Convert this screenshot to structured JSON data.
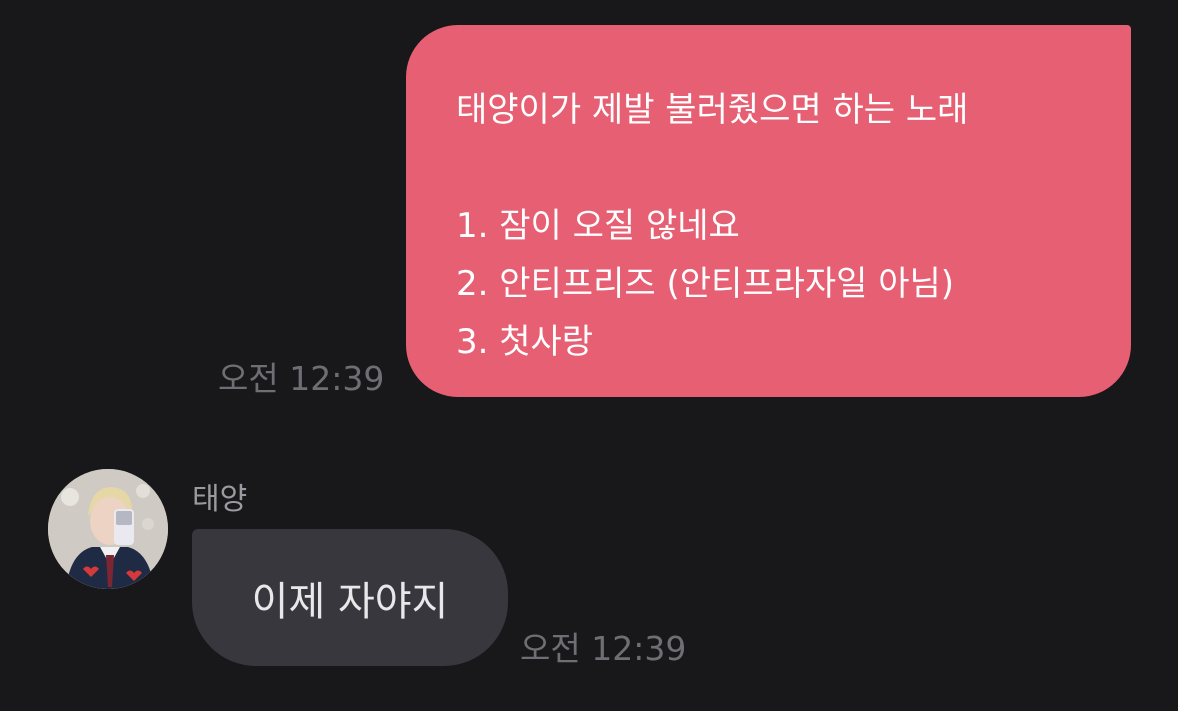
{
  "colors": {
    "background": "#18181b",
    "outgoing_bubble": "#e65f72",
    "incoming_bubble": "#37373d",
    "timestamp": "#6e6e74"
  },
  "messages": {
    "outgoing": {
      "lines": [
        "태양이가 제발 불러줬으면 하는 노래",
        "",
        "1. 잠이 오질 않네요",
        "2. 안티프리즈 (안티프라자일 아님)",
        "3. 첫사랑"
      ],
      "time": "오전 12:39"
    },
    "incoming": {
      "sender": "태양",
      "text": "이제 자야지",
      "time": "오전 12:39",
      "avatar": "profile-photo-icon"
    }
  }
}
